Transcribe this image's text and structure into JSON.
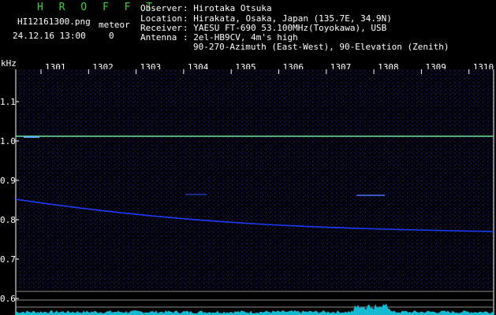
{
  "header": {
    "app_name": "H R O F F T",
    "filename": "HI12161300.png",
    "meteor_label": "meteor",
    "datetime": "24.12.16 13:00",
    "meteor_count": "0",
    "observer_label": "Observer",
    "observer_value": ": Hirotaka Otsuka",
    "location_label": "Location",
    "location_value": ": Hirakata, Osaka, Japan (135.7E, 34.9N)",
    "receiver_label": "Receiver",
    "receiver_value": ": YAESU FT-690 53.100MHz(Toyokawa), USB",
    "antenna_label": "Antenna",
    "antenna_value": ": 2el-HB9CV, 4m's high",
    "antenna_value2": "90-270-Azimuth (East-West), 90-Elevation (Zenith)"
  },
  "axis": {
    "y_unit": "kHz",
    "x_ticks": [
      "1301",
      "1302",
      "1303",
      "1304",
      "1305",
      "1306",
      "1307",
      "1308",
      "1309",
      "1310"
    ],
    "y_ticks": [
      "1.1",
      "1.0",
      "0.9",
      "0.8",
      "0.7",
      "0.6"
    ]
  },
  "colors": {
    "background": "#000000",
    "text": "#ffffff",
    "title_green": "#3cd23c",
    "carrier_line": "#6fe39a",
    "drift_line": "#1e3cff",
    "noise": "#1a1a6e"
  }
}
